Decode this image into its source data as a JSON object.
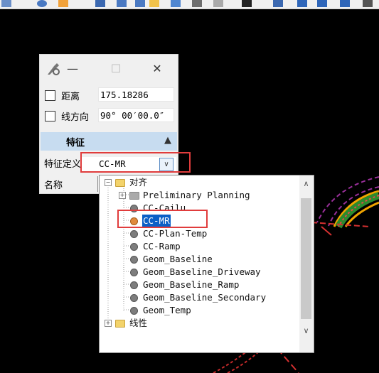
{
  "panel": {
    "minimize_glyph": "—",
    "maximize_glyph": "☐",
    "close_glyph": "✕",
    "distance": {
      "label": "距离",
      "value": "175.18286"
    },
    "direction": {
      "label": "线方向",
      "value": "90° 00′00.0″"
    },
    "section_title": "特征",
    "section_chevron": "▲",
    "feature_def_label": "特征定义",
    "feature_def_value": "CC-MR",
    "dropdown_glyph": "∨",
    "name_label": "名称"
  },
  "tree": {
    "nodes": [
      {
        "label": "对齐",
        "type": "folder",
        "expander": "−"
      },
      {
        "label": "Preliminary Planning",
        "type": "folder-grey",
        "expander": "+"
      },
      {
        "label": "CC-Cailu",
        "type": "feature"
      },
      {
        "label": "CC-MR",
        "type": "feature",
        "selected": true
      },
      {
        "label": "CC-Plan-Temp",
        "type": "feature"
      },
      {
        "label": "CC-Ramp",
        "type": "feature"
      },
      {
        "label": "Geom_Baseline",
        "type": "feature"
      },
      {
        "label": "Geom_Baseline_Driveway",
        "type": "feature"
      },
      {
        "label": "Geom_Baseline_Ramp",
        "type": "feature"
      },
      {
        "label": "Geom_Baseline_Secondary",
        "type": "feature"
      },
      {
        "label": "Geom_Temp",
        "type": "feature"
      },
      {
        "label": "线性",
        "type": "folder",
        "expander": "+"
      }
    ],
    "scroll_up": "∧",
    "scroll_down": "∨"
  },
  "colors": {
    "highlight": "#e03c3c",
    "selection": "#0a5fc6",
    "section_bg": "#c7dcf0",
    "canvas": "#000000"
  }
}
